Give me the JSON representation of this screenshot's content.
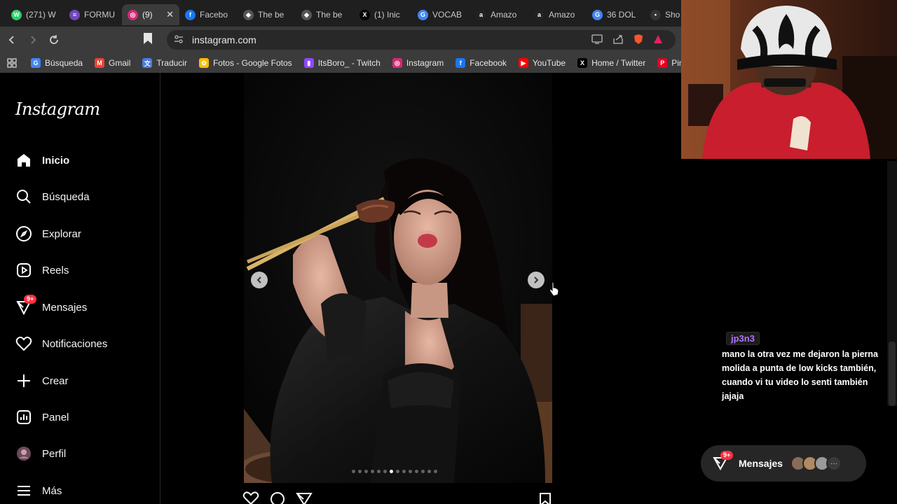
{
  "browser": {
    "tabs": [
      {
        "label": "(271) W",
        "icon": "whatsapp-icon",
        "color": "#25d366",
        "glyph": "W"
      },
      {
        "label": "FORMU",
        "icon": "forms-icon",
        "color": "#7248b9",
        "glyph": "≡"
      },
      {
        "label": "(9)",
        "icon": "instagram-icon",
        "color": "#d62976",
        "glyph": "◎",
        "active": true
      },
      {
        "label": "Facebo",
        "icon": "facebook-icon",
        "color": "#1877f2",
        "glyph": "f"
      },
      {
        "label": "The be",
        "icon": "diamond-icon",
        "color": "#555",
        "glyph": "◆"
      },
      {
        "label": "The be",
        "icon": "diamond-icon",
        "color": "#555",
        "glyph": "◆"
      },
      {
        "label": "(1) Inic",
        "icon": "x-icon",
        "color": "#000",
        "glyph": "X"
      },
      {
        "label": "VOCAB",
        "icon": "google-icon",
        "color": "#4285f4",
        "glyph": "G"
      },
      {
        "label": "Amazo",
        "icon": "amazon-icon",
        "color": "#222",
        "glyph": "a"
      },
      {
        "label": "Amazo",
        "icon": "amazon-icon",
        "color": "#222",
        "glyph": "a"
      },
      {
        "label": "36 DOL",
        "icon": "google-icon",
        "color": "#4285f4",
        "glyph": "G"
      },
      {
        "label": "Sho",
        "icon": "page-icon",
        "color": "#333",
        "glyph": "•"
      }
    ],
    "tab_close": "✕",
    "url": "instagram.com",
    "bookmarks": [
      {
        "label": "Búsqueda",
        "icon": "google-icon",
        "color": "#4285f4",
        "glyph": "G"
      },
      {
        "label": "Gmail",
        "icon": "gmail-icon",
        "color": "#ea4335",
        "glyph": "M"
      },
      {
        "label": "Traducir",
        "icon": "translate-icon",
        "color": "#4a7be2",
        "glyph": "文"
      },
      {
        "label": "Fotos - Google Fotos",
        "icon": "photos-icon",
        "color": "#fbbc04",
        "glyph": "✿"
      },
      {
        "label": "ItsBoro_ - Twitch",
        "icon": "twitch-icon",
        "color": "#9146ff",
        "glyph": "▮"
      },
      {
        "label": "Instagram",
        "icon": "instagram-icon",
        "color": "#d62976",
        "glyph": "◎"
      },
      {
        "label": "Facebook",
        "icon": "facebook-icon",
        "color": "#1877f2",
        "glyph": "f"
      },
      {
        "label": "YouTube",
        "icon": "youtube-icon",
        "color": "#ff0000",
        "glyph": "▶"
      },
      {
        "label": "Home / Twitter",
        "icon": "x-icon",
        "color": "#000",
        "glyph": "X"
      },
      {
        "label": "Pinterest - (",
        "icon": "pinterest-icon",
        "color": "#e60023",
        "glyph": "P"
      }
    ]
  },
  "instagram": {
    "logo": "Instagram",
    "nav": [
      {
        "label": "Inicio",
        "icon": "home-icon",
        "bold": true
      },
      {
        "label": "Búsqueda",
        "icon": "search-icon"
      },
      {
        "label": "Explorar",
        "icon": "compass-icon"
      },
      {
        "label": "Reels",
        "icon": "reels-icon"
      },
      {
        "label": "Mensajes",
        "icon": "messenger-icon",
        "badge": "9+"
      },
      {
        "label": "Notificaciones",
        "icon": "heart-icon"
      },
      {
        "label": "Crear",
        "icon": "plus-icon"
      },
      {
        "label": "Panel",
        "icon": "chart-icon"
      },
      {
        "label": "Perfil",
        "icon": "avatar-icon"
      },
      {
        "label": "Más",
        "icon": "menu-icon"
      }
    ],
    "carousel": {
      "dots": 14,
      "active_dot": 6
    },
    "messages_pill": {
      "label": "Mensajes",
      "badge": "9+",
      "more": "···"
    }
  },
  "chat": {
    "user": "jp3n3",
    "message": "mano la otra vez me dejaron la pierna molida a punta de low kicks también, cuando vi tu video lo senti también jajaja"
  },
  "colors": {
    "accent_badge": "#ff3040",
    "chat_user": "#b073ff"
  }
}
